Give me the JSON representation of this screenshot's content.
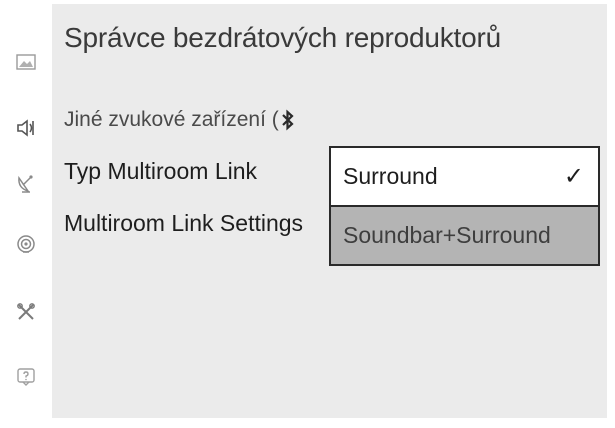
{
  "panel": {
    "title": "Správce bezdrátových reproduktorů",
    "subtitle": "Jiné zvukové zařízení ("
  },
  "menu": {
    "items": [
      {
        "label": "Typ Multiroom Link"
      },
      {
        "label": "Multiroom Link Settings"
      }
    ]
  },
  "dropdown": {
    "options": [
      {
        "label": "Surround",
        "selected": true
      },
      {
        "label": "Soundbar+Surround",
        "selected": false
      }
    ],
    "check_mark": "✓"
  },
  "sidebar": {
    "icons": [
      "picture-icon",
      "speaker-icon",
      "satellite-dish-icon",
      "network-icon",
      "tools-icon",
      "help-icon"
    ]
  },
  "colors": {
    "panel_bg": "#ebebeb",
    "highlight_bg": "#b4b4b4",
    "border": "#2a2a2a"
  }
}
